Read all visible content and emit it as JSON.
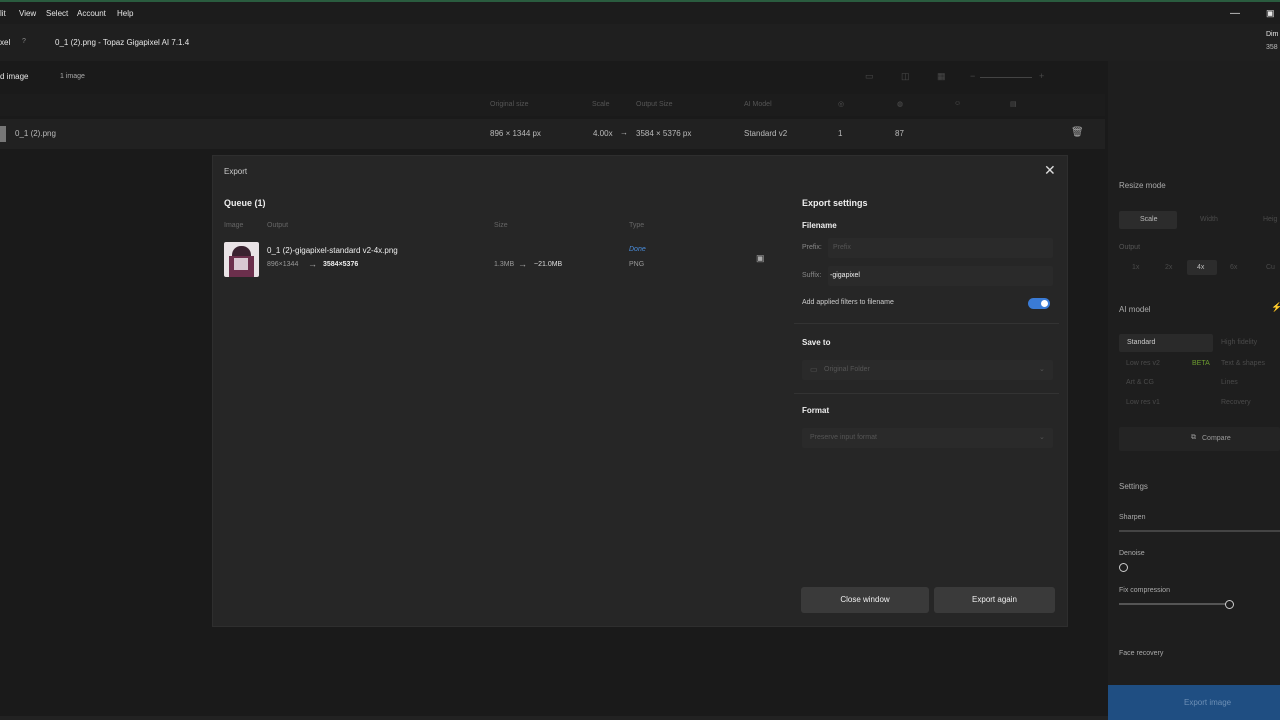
{
  "menu": [
    "lit",
    "View",
    "Select",
    "Account",
    "Help"
  ],
  "title": {
    "app_short": "xel",
    "badge": "?",
    "window_title": "0_1 (2).png - Topaz Gigapixel AI 7.1.4",
    "dim_label": "Dim",
    "dim_value": "358"
  },
  "subbar": {
    "tab": "d image",
    "count": "1 image"
  },
  "columns": [
    "Original size",
    "Scale",
    "Output Size",
    "AI Model"
  ],
  "file_row": {
    "name": "0_1 (2).png",
    "original": "896 × 1344 px",
    "scale": "4.00x",
    "arrow": "→",
    "output": "3584 × 5376 px",
    "model": "Standard v2",
    "v1": "1",
    "v2": "87"
  },
  "right_panel": {
    "resize_mode": "Resize mode",
    "scale_tab": "Scale",
    "width_tab": "Width",
    "height_tab": "Heig",
    "output": "Output",
    "scales": [
      "1x",
      "2x",
      "4x",
      "6x",
      "Cu"
    ],
    "ai_model": "AI model",
    "models": [
      "Standard",
      "High fidelity",
      "Low res v2",
      "Text & shapes",
      "Art & CG",
      "Lines",
      "Low res v1",
      "Recovery"
    ],
    "beta": "BETA",
    "compare": "Compare",
    "settings": "Settings",
    "sharpen": "Sharpen",
    "denoise": "Denoise",
    "fix_compression": "Fix compression",
    "face_recovery": "Face recovery",
    "export_image": "Export image"
  },
  "modal": {
    "title": "Export",
    "queue_title": "Queue (1)",
    "col_image": "Image",
    "col_output": "Output",
    "col_size": "Size",
    "col_type": "Type",
    "item": {
      "filename": "0_1 (2)-gigapixel-standard v2-4x.png",
      "dims_from": "896×1344",
      "arrow": "→",
      "dims_to": "3584×5376",
      "size_from": "1.3MB",
      "size_to": "~21.0MB",
      "status": "Done",
      "type": "PNG"
    },
    "export_settings": "Export settings",
    "filename_label": "Filename",
    "prefix_label": "Prefix:",
    "prefix_placeholder": "Prefix",
    "suffix_label": "Suffix:",
    "suffix_value": "-gigapixel",
    "add_filters": "Add applied filters to filename",
    "add_filters_on": true,
    "save_to_label": "Save to",
    "save_to_value": "Original Folder",
    "format_label": "Format",
    "format_value": "Preserve input format",
    "close_button": "Close window",
    "export_again_button": "Export again"
  }
}
